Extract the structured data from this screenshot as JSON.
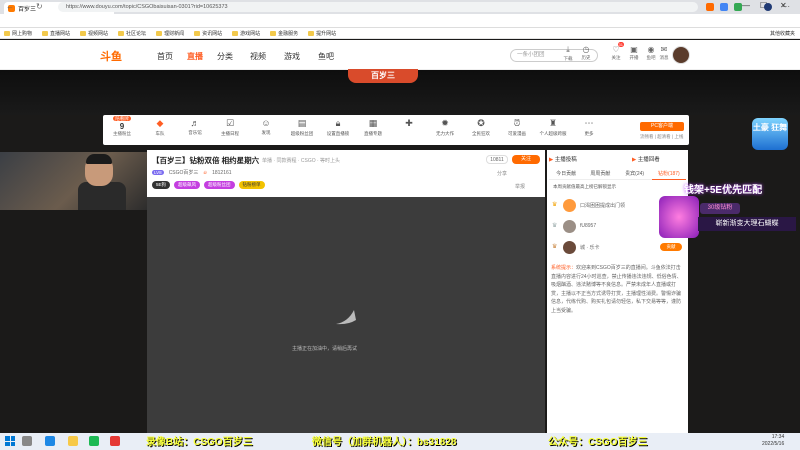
{
  "browser": {
    "tab_title": "百岁三",
    "url": "https://www.douyu.com/topic/CSGObaisuisan-0301?rid=10625373",
    "bookmarks": [
      "网上购物",
      "直播网站",
      "视频网站",
      "社区论坛",
      "理财新闻",
      "资讯网站",
      "游戏网站",
      "金融服务",
      "提升网站"
    ],
    "bookmark_right": "其他收藏夹"
  },
  "site": {
    "logo": "斗鱼",
    "nav": [
      "首页",
      "直播",
      "分类",
      "视频",
      "游戏",
      "鱼吧"
    ],
    "nav_active": "直播",
    "search_placeholder": "一条小团团",
    "header_icons": [
      {
        "label": "下载",
        "icon": "download-icon"
      },
      {
        "label": "历史",
        "icon": "history-icon"
      },
      {
        "label": "关注",
        "icon": "heart-icon",
        "badge": "31"
      },
      {
        "label": "开播",
        "icon": "camera-icon"
      },
      {
        "label": "鱼吧",
        "icon": "fish-icon"
      },
      {
        "label": "消息",
        "icon": "bell-icon"
      },
      {
        "label": "个人中心",
        "icon": "user-icon"
      }
    ]
  },
  "banner": {
    "name": "百岁三"
  },
  "toolbar": {
    "level_tag": "陪看牌",
    "level_num": "9",
    "level_sub": "主播粉丝",
    "items": [
      {
        "label": "车队",
        "icon": "car-icon"
      },
      {
        "label": "音乐馆",
        "icon": "music-icon"
      },
      {
        "label": "主播日程",
        "icon": "calendar-icon"
      },
      {
        "label": "发现",
        "icon": "discover-icon"
      },
      {
        "label": "超级粉丝团",
        "icon": "fans-icon"
      },
      {
        "label": "设置直播锁",
        "icon": "lock-icon"
      },
      {
        "label": "直播专题",
        "icon": "topic-icon"
      },
      {
        "label": "",
        "icon": "gift-icon"
      },
      {
        "label": "无力大作",
        "icon": "fire-icon"
      },
      {
        "label": "全民狂欢",
        "icon": "party-icon"
      },
      {
        "label": "可爱漫画",
        "icon": "clock-icon"
      },
      {
        "label": "个人超级跨服",
        "icon": "trophy-icon"
      },
      {
        "label": "更多",
        "icon": "more-icon"
      }
    ],
    "pc_button": "PC客户端",
    "pc_sub": "流畅看 | 超清看 | 上线"
  },
  "room": {
    "title": "【百岁三】钻粉双倍 相约星期六",
    "category": "单播 · 同款赛程 · CSGO · 等时上头",
    "room_id": "10811",
    "follow_label": "关注",
    "anchor_level": "LV8",
    "anchor_name": "CSGO百岁三",
    "hot": "1812161",
    "tags": [
      {
        "label": "5E狗",
        "color": "#333333"
      },
      {
        "label": "超级飙风",
        "color": "#c43ee0"
      },
      {
        "label": "超级粉丝团",
        "color": "#c43ee0"
      },
      {
        "label": "钻粉榜单",
        "color": "#f2c200"
      }
    ],
    "share": "分享",
    "report": "举报",
    "player_message": "主播正在加油中，请稍后再试"
  },
  "chat": {
    "header_left": "主播投稿",
    "header_right": "主播回看",
    "tabs": [
      "今日贡献",
      "周周贡献",
      "贵宾(24)",
      "钻粉(187)"
    ],
    "rank_tip": "本周贡献值最高上榜已解锁显示",
    "ranking": [
      {
        "name": "口渴困困提成出门领",
        "button": "贡献"
      },
      {
        "name": "fU8957",
        "button": "贡献"
      },
      {
        "name": "城 · 乐卡",
        "button": "贡献"
      }
    ],
    "system_label": "系统提示：",
    "system_text": "欢迎来到CSGO百岁三的直播间。斗鱼依法打击直播内容进行24小时巡查，禁止传播违法违规、低俗色情、吸烟酗酒、违法赌博等不良信息。严禁未成年人直播或打赏，主播以不正当方式诱导打赏，主播理性消费。警惕诈骗信息，代练代购、购买礼包请勿轻信，私下交易等等，谨防上当受骗。"
  },
  "overlay": {
    "badge_text": "土豪 狂舞",
    "promo_line": "钱架+5E优先匹配",
    "gift_count": "30级钻粉",
    "gift_name": "崭新渐变大理石蝴蝶",
    "bottom_1": "录像B站：CSGO百岁三",
    "bottom_2": "微信号（加群机器人）：bs31828",
    "bottom_3": "公众号：CSGO百岁三"
  },
  "taskbar": {
    "time": "17:34",
    "date": "2022/5/16"
  }
}
